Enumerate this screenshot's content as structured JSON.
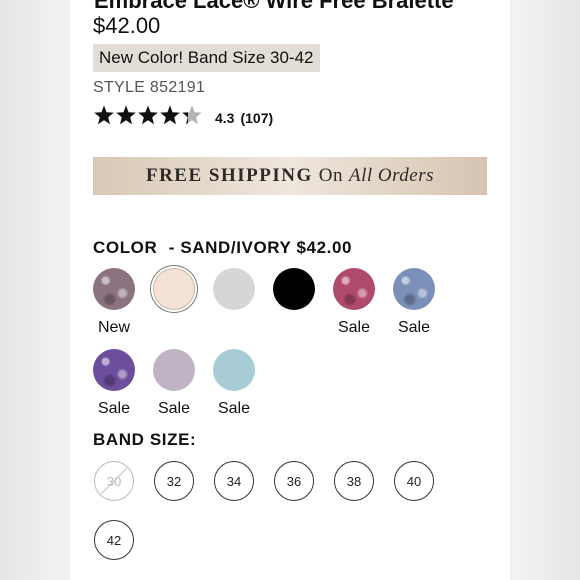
{
  "product": {
    "title": "Embrace Lace® Wire Free Bralette",
    "price": "$42.00",
    "promo": "New Color! Band Size 30-42",
    "style": "STYLE 852191",
    "rating": {
      "stars": 4.3,
      "value": "4.3",
      "count": "(107)"
    }
  },
  "banner": {
    "part1": "FREE SHIPPING",
    "part2": "On",
    "part3": "All Orders"
  },
  "color": {
    "label": "COLOR",
    "separator": "-",
    "selected_name": "SAND/IVORY",
    "selected_price": "$42.00",
    "swatches": [
      {
        "name": "purple-gray-pattern",
        "color": "#8c7380",
        "label": "New",
        "selected": false
      },
      {
        "name": "sand-ivory",
        "color": "#f4e2d6",
        "label": "",
        "selected": true
      },
      {
        "name": "light-gray",
        "color": "#d6d6d6",
        "label": "",
        "selected": false
      },
      {
        "name": "black",
        "color": "#000000",
        "label": "",
        "selected": false
      },
      {
        "name": "pink-floral",
        "color": "#b04a6a",
        "label": "Sale",
        "selected": false
      },
      {
        "name": "blue-floral",
        "color": "#7b90b8",
        "label": "Sale",
        "selected": false
      },
      {
        "name": "violet-floral",
        "color": "#6c4e9c",
        "label": "Sale",
        "selected": false
      },
      {
        "name": "lilac",
        "color": "#bfb3c4",
        "label": "Sale",
        "selected": false
      },
      {
        "name": "aqua",
        "color": "#a8ccd6",
        "label": "Sale",
        "selected": false
      }
    ]
  },
  "band": {
    "label": "BAND SIZE:",
    "sizes": [
      {
        "value": "30",
        "available": false
      },
      {
        "value": "32",
        "available": true
      },
      {
        "value": "34",
        "available": true
      },
      {
        "value": "36",
        "available": true
      },
      {
        "value": "38",
        "available": true
      },
      {
        "value": "40",
        "available": true
      },
      {
        "value": "42",
        "available": true
      }
    ]
  }
}
